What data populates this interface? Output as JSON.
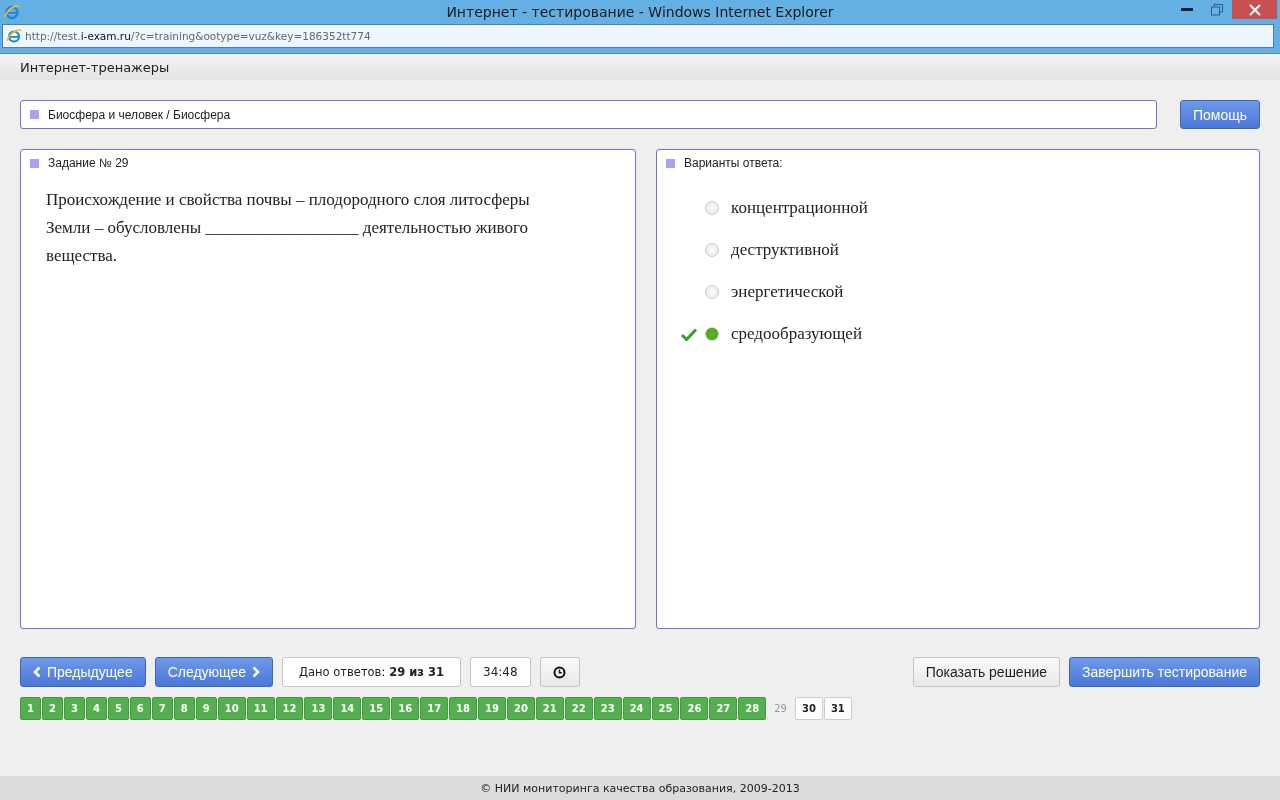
{
  "window": {
    "title": "Интернет - тестирование - Windows Internet Explorer"
  },
  "address_bar": {
    "url_prefix": "http://test.",
    "url_domain": "i-exam.ru",
    "url_rest": "/?c=training&ootype=vuz&key=186352tt774"
  },
  "site_header": {
    "title": "Интернет-тренажеры"
  },
  "topic": {
    "path": "Биосфера и человек / Биосфера"
  },
  "help_button": "Помощь",
  "task": {
    "title": "Задание № 29",
    "text": "Происхождение и свойства почвы – плодородного слоя литосферы Земли – обусловлены __________________ деятельностью живого вещества."
  },
  "answers": {
    "title": "Варианты ответа:",
    "options": [
      {
        "label": "концентрационной",
        "selected": false,
        "correct": false
      },
      {
        "label": "деструктивной",
        "selected": false,
        "correct": false
      },
      {
        "label": "энергетической",
        "selected": false,
        "correct": false
      },
      {
        "label": "средообразующей",
        "selected": true,
        "correct": true
      }
    ]
  },
  "nav": {
    "prev": "Предыдущее",
    "next": "Следующее",
    "answered_label": "Дано ответов:",
    "answered_count": "29 из 31",
    "timer": "34:48",
    "show_solution": "Показать решение",
    "finish": "Завершить тестирование"
  },
  "pages": [
    {
      "label": "1",
      "answered": true,
      "selected": false
    },
    {
      "label": "2",
      "answered": true,
      "selected": false
    },
    {
      "label": "3",
      "answered": true,
      "selected": false
    },
    {
      "label": "4",
      "answered": true,
      "selected": false
    },
    {
      "label": "5",
      "answered": true,
      "selected": false
    },
    {
      "label": "6",
      "answered": true,
      "selected": false
    },
    {
      "label": "7",
      "answered": true,
      "selected": false
    },
    {
      "label": "8",
      "answered": true,
      "selected": false
    },
    {
      "label": "9",
      "answered": true,
      "selected": false
    },
    {
      "label": "10",
      "answered": true,
      "selected": false
    },
    {
      "label": "11",
      "answered": true,
      "selected": false
    },
    {
      "label": "12",
      "answered": true,
      "selected": false
    },
    {
      "label": "13",
      "answered": true,
      "selected": false
    },
    {
      "label": "14",
      "answered": true,
      "selected": false
    },
    {
      "label": "15",
      "answered": true,
      "selected": false
    },
    {
      "label": "16",
      "answered": true,
      "selected": false
    },
    {
      "label": "17",
      "answered": true,
      "selected": false
    },
    {
      "label": "18",
      "answered": true,
      "selected": false
    },
    {
      "label": "19",
      "answered": true,
      "selected": false
    },
    {
      "label": "20",
      "answered": true,
      "selected": false
    },
    {
      "label": "21",
      "answered": true,
      "selected": false
    },
    {
      "label": "22",
      "answered": true,
      "selected": false
    },
    {
      "label": "23",
      "answered": true,
      "selected": false
    },
    {
      "label": "24",
      "answered": true,
      "selected": false
    },
    {
      "label": "25",
      "answered": true,
      "selected": false
    },
    {
      "label": "26",
      "answered": true,
      "selected": false
    },
    {
      "label": "27",
      "answered": true,
      "selected": false
    },
    {
      "label": "28",
      "answered": true,
      "selected": false
    },
    {
      "label": "29",
      "answered": false,
      "selected": true
    },
    {
      "label": "30",
      "answered": false,
      "selected": false
    },
    {
      "label": "31",
      "answered": false,
      "selected": false
    }
  ],
  "footer": "© НИИ мониторинга качества образования, 2009-2013"
}
